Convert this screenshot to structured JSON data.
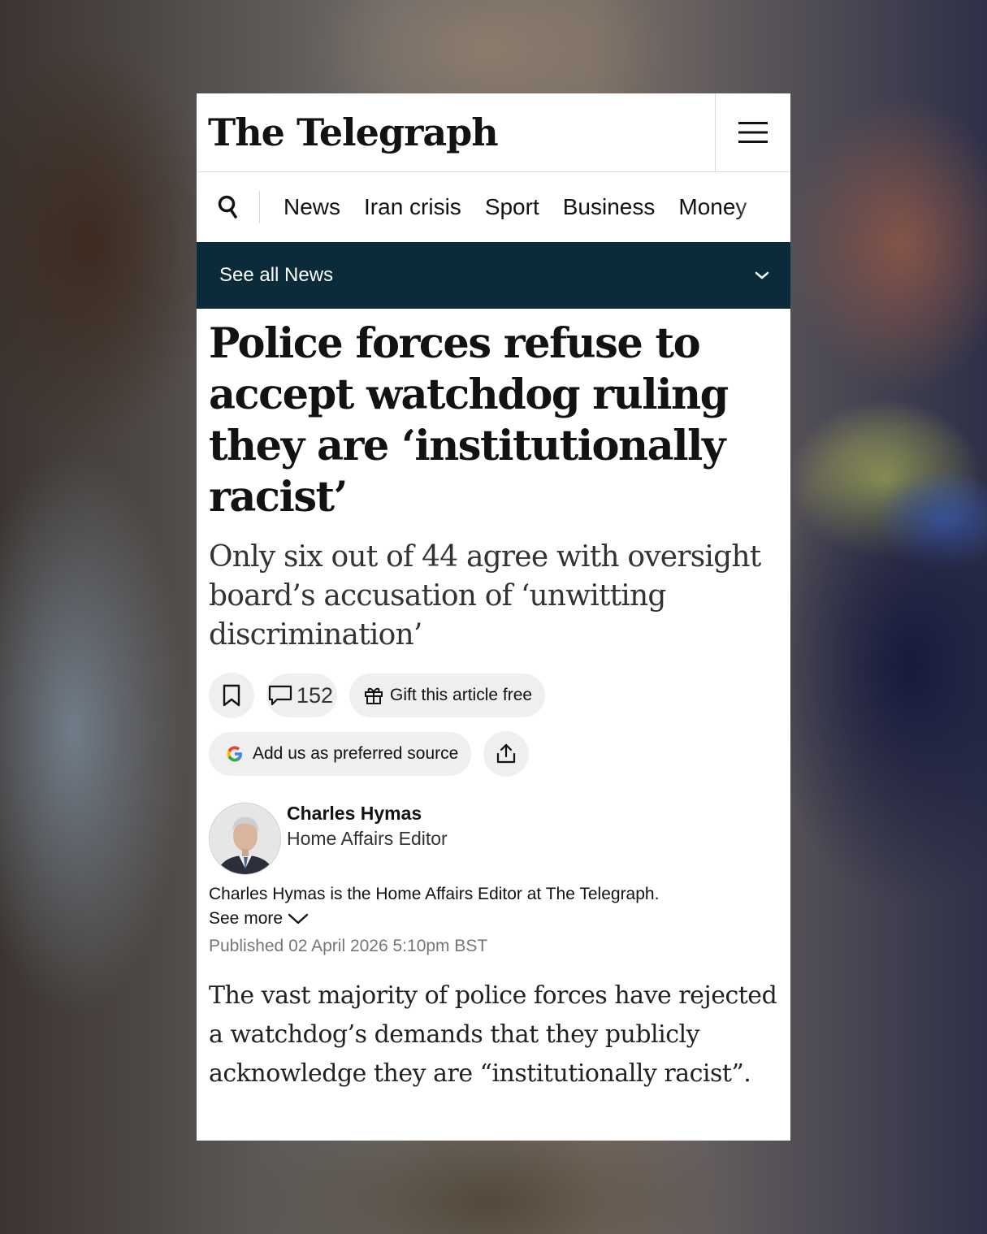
{
  "header": {
    "logo_text": "The Telegraph",
    "menu_icon": "hamburger-menu-icon"
  },
  "nav": {
    "search_icon": "search-icon",
    "items": [
      "News",
      "Iran crisis",
      "Sport",
      "Business",
      "Money"
    ]
  },
  "section": {
    "label": "See all News",
    "toggle_icon": "chevron-down-icon"
  },
  "article": {
    "headline": "Police forces refuse to accept watchdog ruling they are ‘institutionally racist’",
    "standfirst": "Only six out of 44 agree with oversight board’s accusation of ‘unwitting discrimination’",
    "actions": {
      "bookmark_icon": "bookmark-icon",
      "comment_count": "152",
      "gift_label": "Gift this article free",
      "source_label": "Add us as preferred source",
      "share_icon": "share-icon"
    },
    "author": {
      "name": "Charles Hymas",
      "role": "Home Affairs Editor",
      "bio": "Charles Hymas is the Home Affairs Editor at The Telegraph.",
      "see_more": "See more"
    },
    "published": "Published 02 April 2026 5:10pm BST",
    "body": "The vast majority of police forces have rejected a watchdog’s demands that they publicly acknowledge they are “institutionally racist”."
  },
  "colors": {
    "section_bar": "#0b2a3a",
    "pill_bg": "#efefef",
    "text": "#121212",
    "muted": "#767676"
  }
}
